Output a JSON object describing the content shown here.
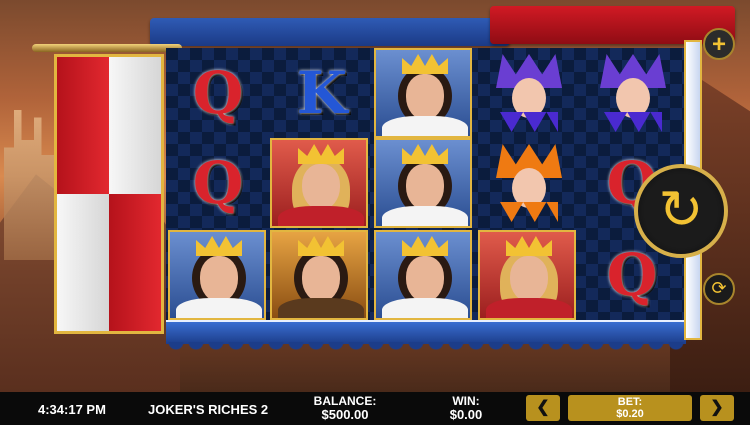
{
  "reels": {
    "col1": [
      {
        "type": "card",
        "glyph": "Q",
        "color": "#d9232c"
      },
      {
        "type": "card",
        "glyph": "Q",
        "color": "#d9232c"
      },
      {
        "type": "king"
      }
    ],
    "col2": [
      {
        "type": "card",
        "glyph": "K",
        "color": "#2457d6"
      },
      {
        "type": "queen"
      },
      {
        "type": "prince"
      }
    ],
    "col3": [
      {
        "type": "king"
      },
      {
        "type": "king"
      },
      {
        "type": "king"
      }
    ],
    "col4": [
      {
        "type": "jester",
        "color": "purple"
      },
      {
        "type": "jester",
        "color": "orange"
      },
      {
        "type": "queen"
      }
    ],
    "col5": [
      {
        "type": "jester",
        "color": "purple"
      },
      {
        "type": "card",
        "glyph": "Q",
        "color": "#d9232c"
      },
      {
        "type": "card",
        "glyph": "Q",
        "color": "#d9232c"
      }
    ]
  },
  "controls": {
    "plus_icon": "+",
    "spin_icon": "↻",
    "autoplay_icon": "⟳"
  },
  "footer": {
    "clock": "4:34:17 PM",
    "game_title": "JOKER'S RICHES 2",
    "balance_label": "BALANCE:",
    "balance_value": "$500.00",
    "win_label": "WIN:",
    "win_value": "$0.00",
    "bet_label": "BET:",
    "bet_value": "$0.20",
    "bet_prev_icon": "❮",
    "bet_next_icon": "❯"
  }
}
